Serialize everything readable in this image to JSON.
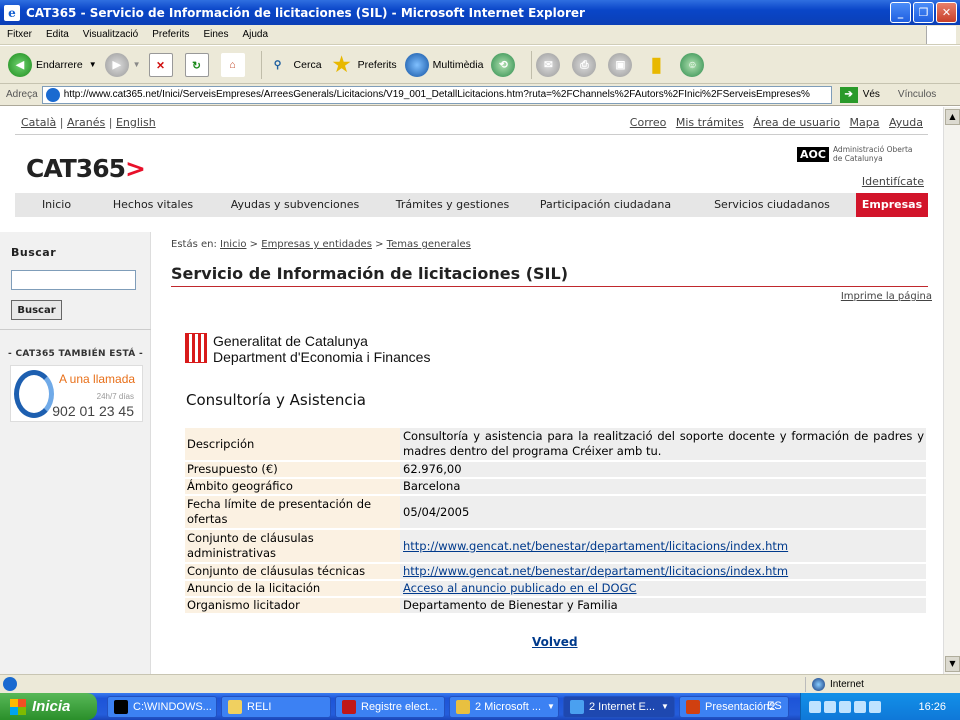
{
  "window": {
    "title": "CAT365 - Servicio de Información de licitaciones (SIL) - Microsoft Internet Explorer",
    "controls": [
      "_",
      "❐",
      "✕"
    ]
  },
  "menu": [
    "Fitxer",
    "Edita",
    "Visualització",
    "Preferits",
    "Eines",
    "Ajuda"
  ],
  "toolbar": {
    "back": "Endarrere",
    "search": "Cerca",
    "favorites": "Preferits",
    "multimedia": "Multimèdia"
  },
  "address": {
    "label": "Adreça",
    "url": "http://www.cat365.net/Inici/ServeisEmpreses/ArreesGenerals/Licitacions/V19_001_DetallLicitacions.htm?ruta=%2FChannels%2FAutors%2FInici%2FServeisEmpreses%",
    "go": "Vés",
    "links": "Vínculos"
  },
  "page": {
    "languages": [
      "Català",
      "Aranés",
      "English"
    ],
    "top_links": [
      "Correo",
      "Mis trámites",
      "Área de usuario",
      "Mapa",
      "Ayuda"
    ],
    "logo_text": "CAT365",
    "aoc_mark": "AOC",
    "aoc_text": "Administració Oberta de Catalunya",
    "identify": "Identifícate",
    "nav": [
      {
        "label": "Inicio",
        "active": false
      },
      {
        "label": "Hechos vitales",
        "active": false
      },
      {
        "label": "Ayudas y subvenciones",
        "active": false
      },
      {
        "label": "Trámites y gestiones",
        "active": false
      },
      {
        "label": "Participación ciudadana",
        "active": false
      },
      {
        "label": "Servicios ciudadanos",
        "active": false
      },
      {
        "label": "Empresas",
        "active": true
      }
    ],
    "sidebar": {
      "search_title": "Buscar",
      "search_value": "",
      "search_button": "Buscar",
      "also_title": "- CAT365 TAMBIÉN ESTÁ -",
      "banner": {
        "line1": "A una llamada",
        "line2": "24h/7 días",
        "phone": "902 01 23 45"
      }
    },
    "breadcrumb": {
      "prefix": "Estás en:",
      "items": [
        "Inicio",
        "Empresas y entidades",
        "Temas generales"
      ],
      "separator": ">"
    },
    "title": "Servicio de Información de licitaciones (SIL)",
    "print_link": "Imprime la página",
    "org": {
      "line1": "Generalitat de Catalunya",
      "line2": "Department d'Economia i Finances"
    },
    "section_title": "Consultoría y Asistencia",
    "details": [
      {
        "key": "Descripción",
        "value": "Consultoría y asistencia para la realització del soporte docente y formación de padres y madres dentro del programa Créixer amb tu.",
        "link": false
      },
      {
        "key": "Presupuesto (€)",
        "value": "62.976,00",
        "link": false
      },
      {
        "key": "Ámbito geográfico",
        "value": "Barcelona",
        "link": false
      },
      {
        "key": "Fecha límite de presentación de ofertas",
        "value": "05/04/2005",
        "link": false
      },
      {
        "key": "Conjunto de cláusulas administrativas",
        "value": "http://www.gencat.net/benestar/departament/licitacions/index.htm",
        "link": true
      },
      {
        "key": "Conjunto de cláusulas técnicas",
        "value": "http://www.gencat.net/benestar/departament/licitacions/index.htm",
        "link": true
      },
      {
        "key": "Anuncio de la licitación",
        "value": "Acceso al anuncio publicado en el DOGC",
        "link": true
      },
      {
        "key": "Organismo licitador",
        "value": "Departamento de Bienestar y Familia",
        "link": false
      }
    ],
    "back_link": "Volved"
  },
  "status": {
    "zone": "Internet"
  },
  "taskbar": {
    "start": "Inicia",
    "tasks": [
      "C:\\WINDOWS...",
      "RELI",
      "Registre elect...",
      "2 Microsoft ...",
      "2 Internet E...",
      "Presentación2"
    ],
    "active_task": 4,
    "lang": "ES",
    "clock": "16:26"
  },
  "colors": {
    "accent_red": "#d2142a",
    "link_blue": "#003a8c",
    "key_bg": "#fbf1e2",
    "value_bg": "#eeeeee"
  }
}
